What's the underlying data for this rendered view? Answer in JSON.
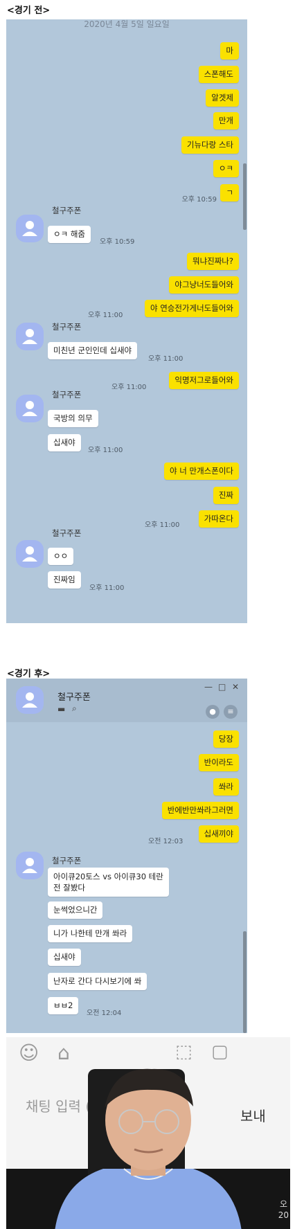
{
  "before": {
    "heading": "<경기 전>",
    "date": "2020년 4월 5일 일요일",
    "messages": [
      {
        "text": "마"
      },
      {
        "text": "스폰해도"
      },
      {
        "text": "알겟제"
      },
      {
        "text": "만개"
      },
      {
        "text": "기뉴다랑 스타"
      },
      {
        "text": "ㅇㅋ"
      },
      {
        "text": "ㄱ"
      },
      {
        "text": "ㅇㅋ 해줌"
      },
      {
        "text": "뭐냐진짜나?"
      },
      {
        "text": "야그냥너도들어와"
      },
      {
        "text": "야 연승전가게너도들어와"
      },
      {
        "text": "미친년 군인인데 십새야"
      },
      {
        "text": "익명저그로들어와"
      },
      {
        "text": "국방의 의무"
      },
      {
        "text": "십새야"
      },
      {
        "text": "야 너 만개스폰이다"
      },
      {
        "text": "진짜"
      },
      {
        "text": "가따온다"
      },
      {
        "text": "ㅇㅇ"
      },
      {
        "text": "진짜임"
      }
    ],
    "times": [
      "오후 10:59",
      "오후 10:59",
      "오후 11:00",
      "오후 11:00",
      "오후 11:00",
      "오후 11:00",
      "오후 11:00",
      "오후 11:00"
    ],
    "sender": "철구주폰"
  },
  "after": {
    "heading": "<경기 후>",
    "title": "철구주폰",
    "window_controls": {
      "minimize": "—",
      "maximize": "□",
      "close": "✕"
    },
    "messages": [
      {
        "text": "당장"
      },
      {
        "text": "반이라도"
      },
      {
        "text": "쏴라"
      },
      {
        "text": "반에반만쏴라그러면"
      },
      {
        "text": "십새끼야"
      },
      {
        "text": "아이큐20토스 vs 아이큐30 테란"
      },
      {
        "text": "전 잘봤다"
      },
      {
        "text": "눈썩었으니간"
      },
      {
        "text": "니가 나한테 만개 쏴라"
      },
      {
        "text": "십새야"
      },
      {
        "text": "난자로 간다 다시보기에 쏴"
      },
      {
        "text": "ㅂㅂ2"
      }
    ],
    "times": [
      "오전 12:03",
      "오전 12:04"
    ],
    "sender": "철구주폰"
  },
  "video": {
    "input_placeholder": "채팅 입력 (",
    "send_partial": "보내",
    "corner_partial": "오",
    "corner_partial2": "20"
  },
  "colors": {
    "chat_bg": "#b2c7da",
    "my_bubble": "#fae100",
    "other_bubble": "#ffffff",
    "avatar": "#a3b6f0"
  }
}
